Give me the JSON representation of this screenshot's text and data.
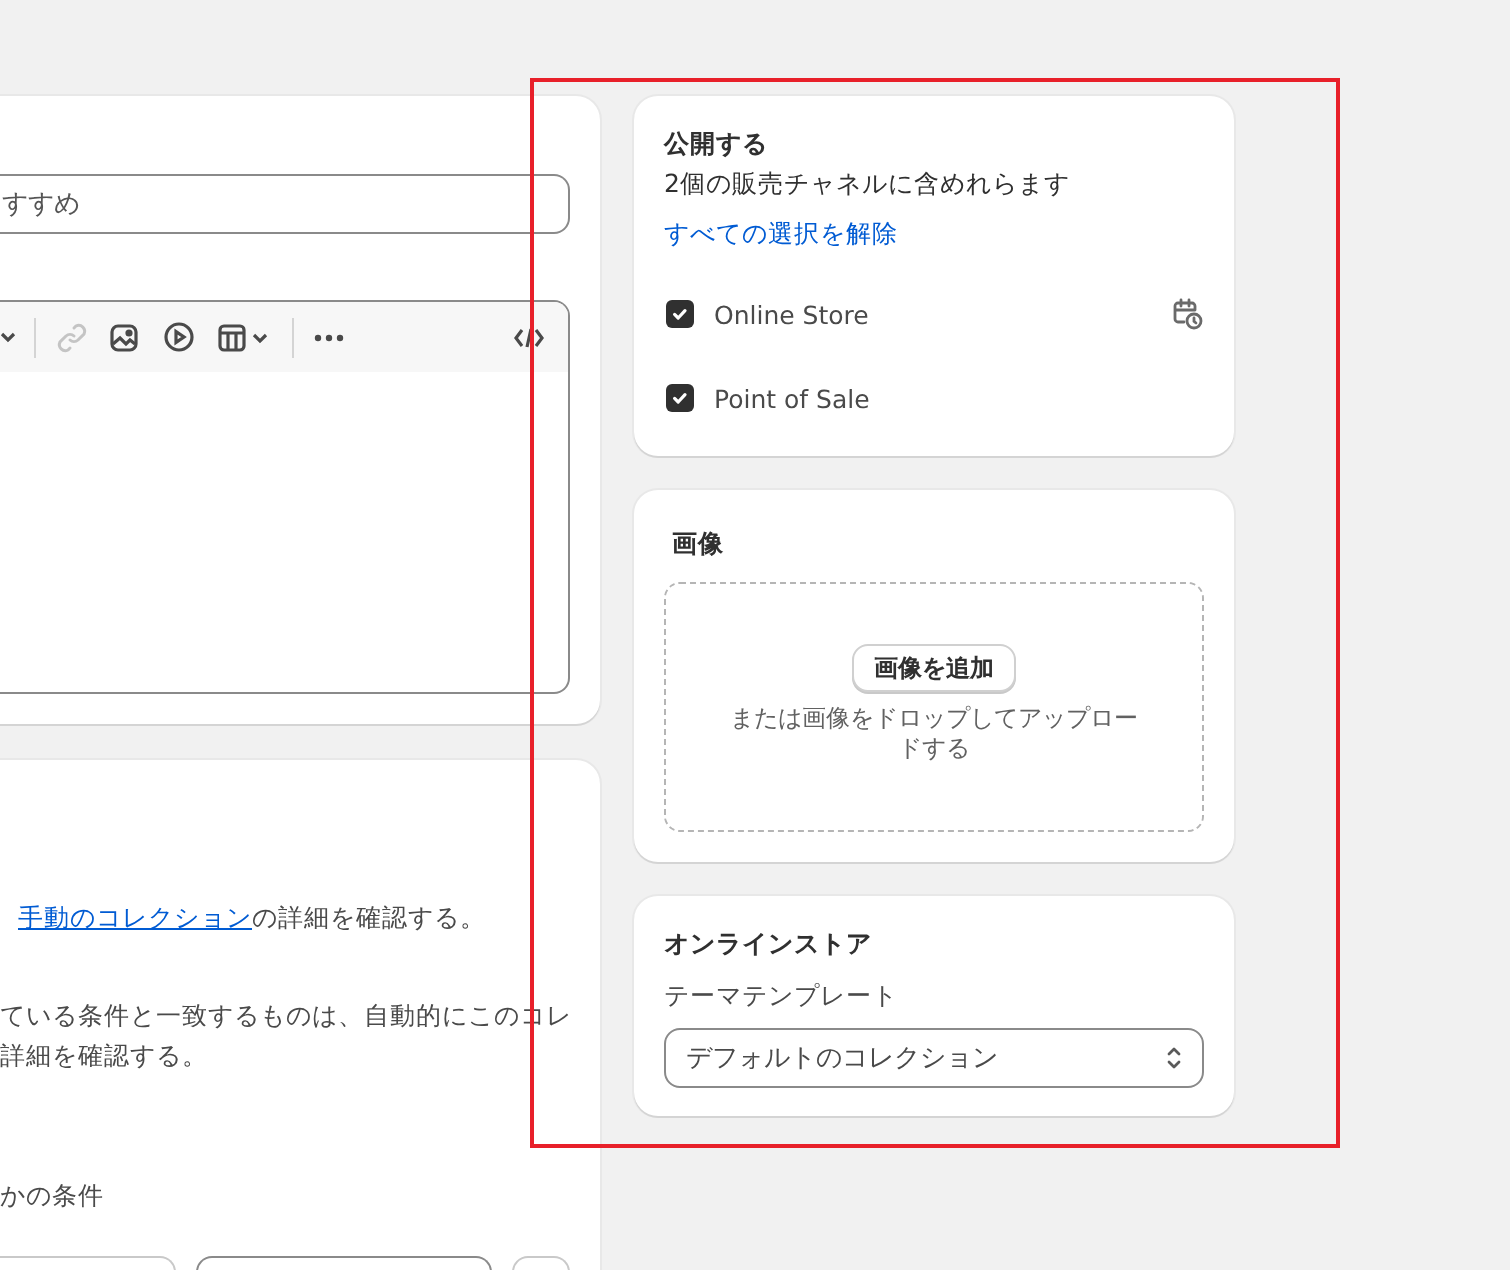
{
  "editor_card": {
    "field_value": "すすめ",
    "toolbar": [
      {
        "kind": "caret",
        "disabled": false
      },
      {
        "kind": "link",
        "disabled": true
      },
      {
        "kind": "image",
        "disabled": false
      },
      {
        "kind": "video",
        "disabled": false
      },
      {
        "kind": "table",
        "disabled": false
      },
      {
        "kind": "more",
        "disabled": false
      },
      {
        "kind": "code",
        "disabled": false
      }
    ]
  },
  "collection_card": {
    "manual_link": "手動のコレクション",
    "manual_text": "の詳細を確認する。",
    "auto_text": [
      "ている条件と一致するものは、自動的にこのコレ",
      "詳細を確認する。"
    ],
    "conditions_label": "かの条件"
  },
  "publish_card": {
    "title": "公開する",
    "subtitle": "2個の販売チャネルに含めれらます",
    "clear_link": "すべての選択を解除",
    "channels": [
      {
        "name": "Online Store",
        "checked": true,
        "scheduled": true
      },
      {
        "name": "Point of Sale",
        "checked": true,
        "scheduled": false
      }
    ]
  },
  "image_card": {
    "title": "画像",
    "add_button": "画像を追加",
    "hint": "または画像をドロップしてアップロードする"
  },
  "store_card": {
    "title": "オンラインストア",
    "label": "テーマテンプレート",
    "value": "デフォルトのコレクション"
  },
  "annotation": {
    "kind": "highlight"
  }
}
